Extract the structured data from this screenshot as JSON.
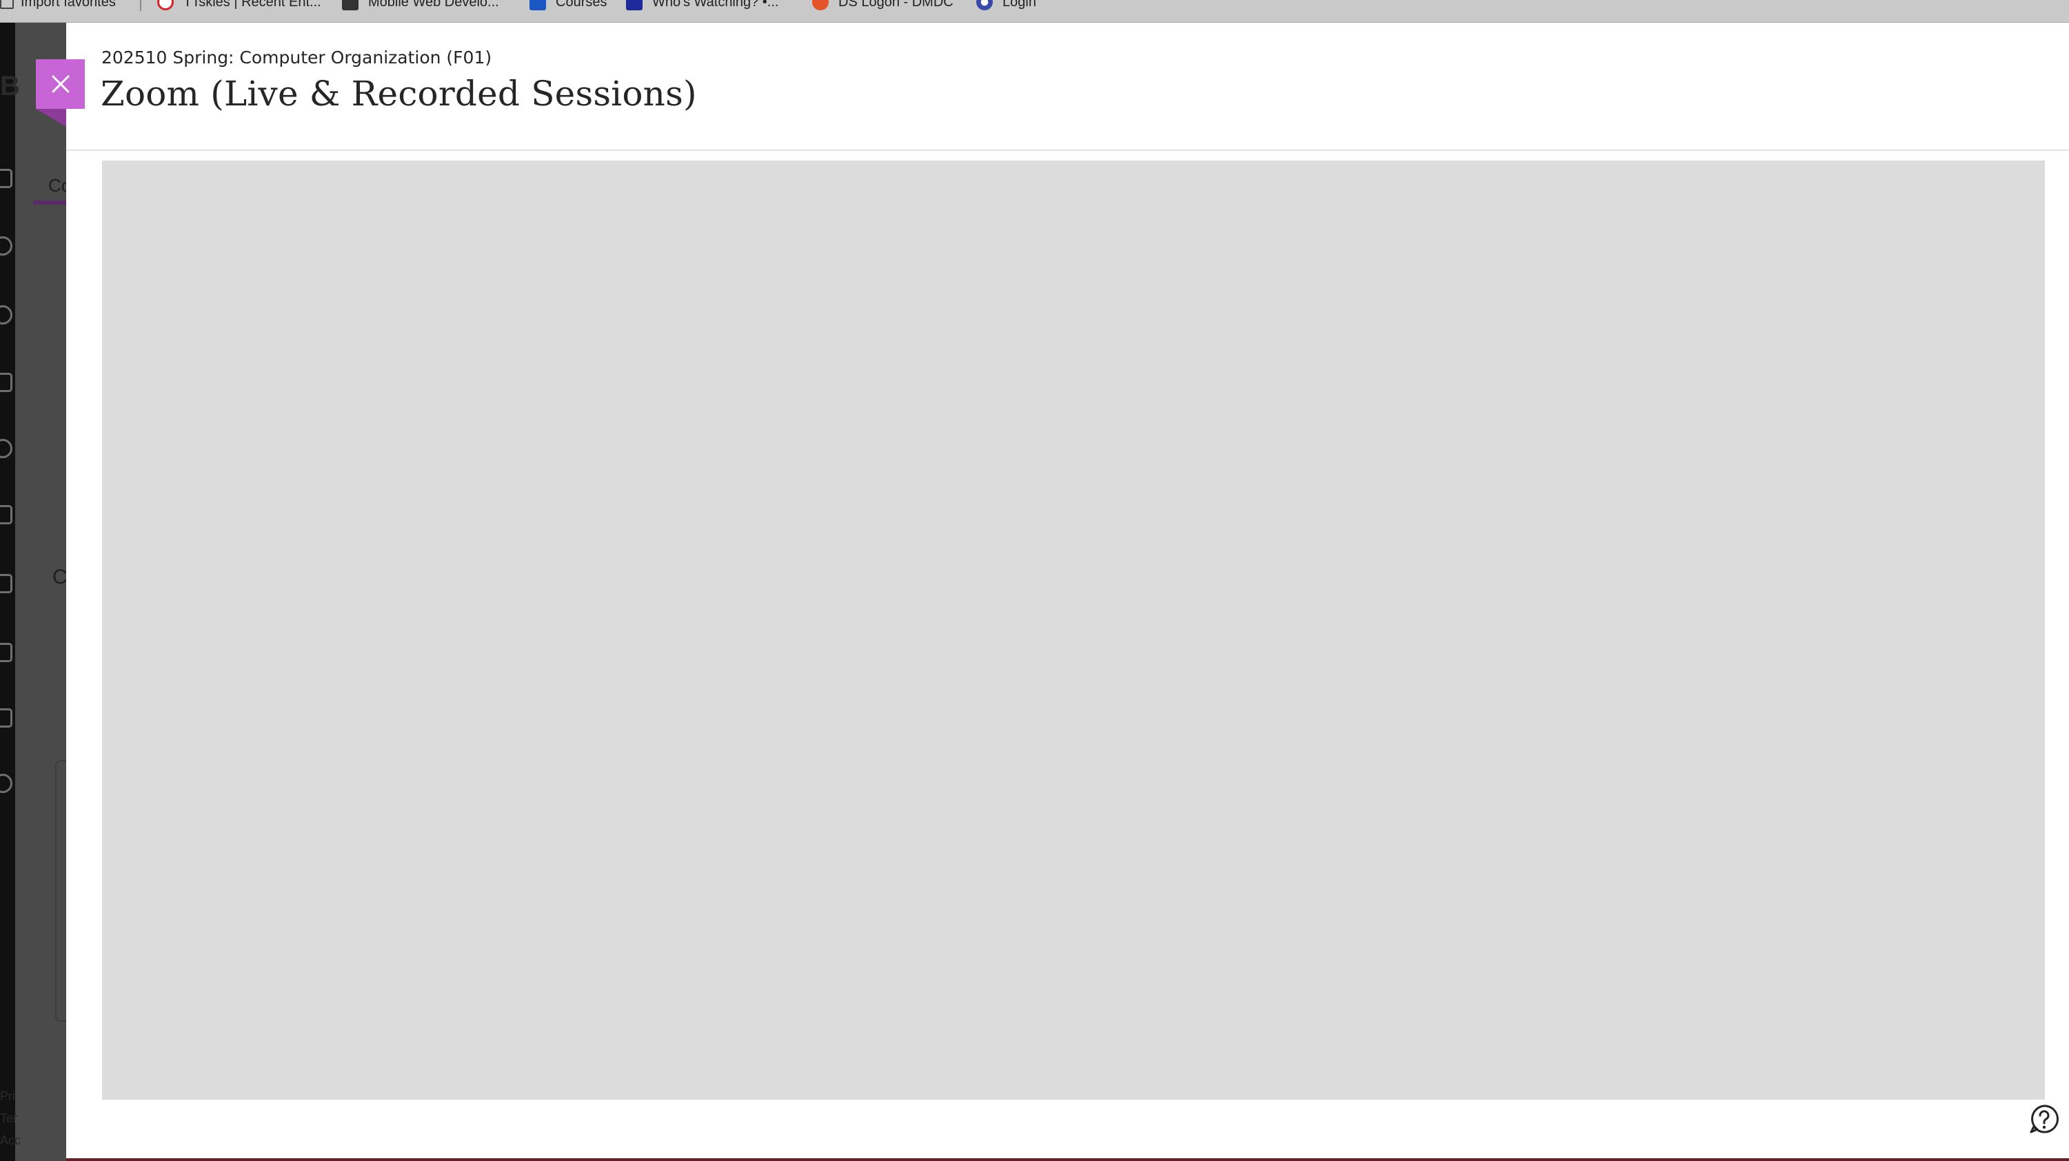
{
  "favorites": [
    {
      "label": "Import favorites",
      "icon": "import-icon",
      "color": "#444444"
    },
    {
      "label": "TTskies | Recent Ent...",
      "icon": "ttskies-icon",
      "color": "#d6252a"
    },
    {
      "label": "Mobile Web Develo...",
      "icon": "mobile-web-icon",
      "color": "#333333"
    },
    {
      "label": "Courses",
      "icon": "courses-icon",
      "color": "#1a56c4"
    },
    {
      "label": "Who's Watching? •...",
      "icon": "watching-icon",
      "color": "#1f2a9c"
    },
    {
      "label": "DS Logon - DMDC",
      "icon": "ds-logon-icon",
      "color": "#e3542b"
    },
    {
      "label": "Login",
      "icon": "login-icon",
      "color": "#3a4aa8"
    }
  ],
  "background": {
    "logo_letter": "B",
    "tab_fragment": "Co",
    "heading_fragment": "C",
    "footer_fragments": [
      "Pri",
      "Ter",
      "Acc"
    ]
  },
  "panel": {
    "course_name": "202510 Spring: Computer Organization (F01)",
    "title": "Zoom (Live & Recorded Sessions)",
    "close_label": "Close",
    "help_label": "Help"
  },
  "colors": {
    "close_button": "#c764d6",
    "frame_placeholder": "#dcdcdc",
    "accent": "#5a2a6a"
  }
}
